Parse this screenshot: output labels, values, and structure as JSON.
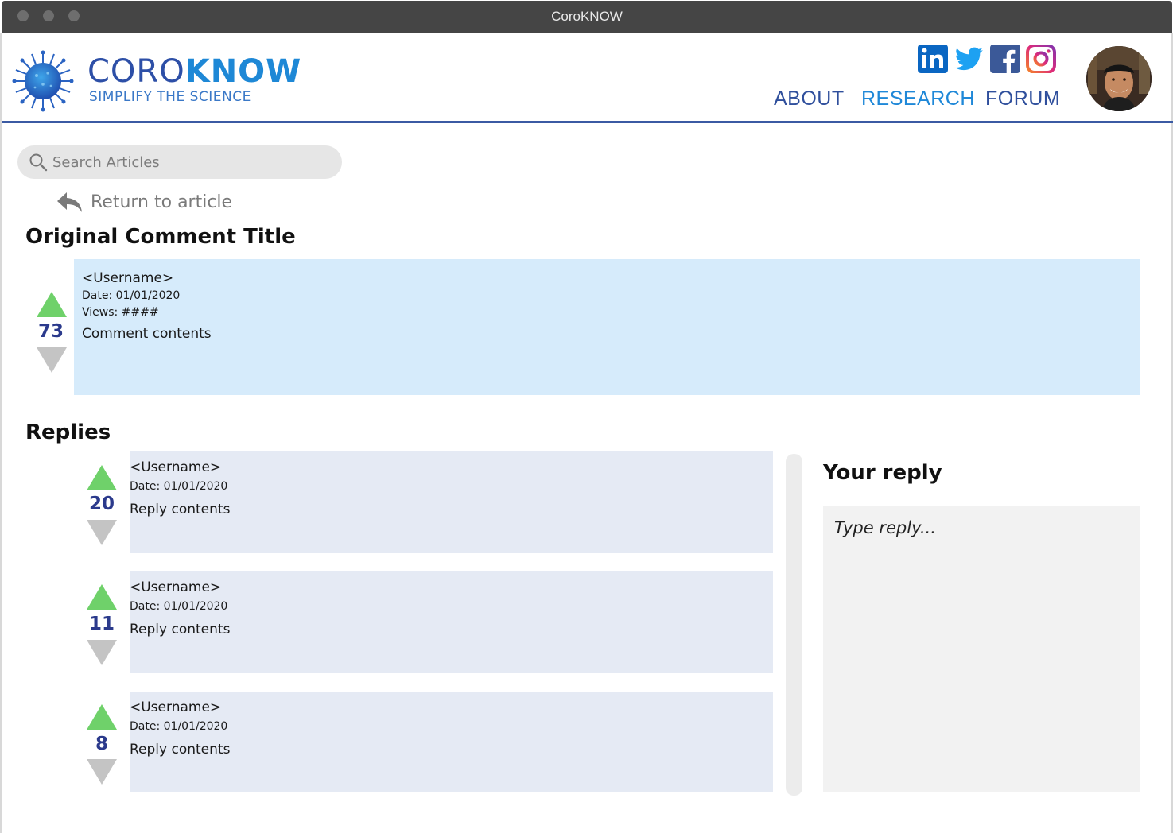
{
  "window": {
    "title": "CoroKNOW"
  },
  "brand": {
    "name_light": "CORO",
    "name_bold": "KNOW",
    "tagline": "SIMPLIFY THE SCIENCE"
  },
  "social": [
    {
      "name": "linkedin-icon",
      "label": "in",
      "color": "#0a66c2"
    },
    {
      "name": "twitter-icon",
      "color": "#1da1f2"
    },
    {
      "name": "facebook-icon",
      "label": "f",
      "color": "#3b5998"
    },
    {
      "name": "instagram-icon",
      "color": "#c13584"
    }
  ],
  "nav": {
    "about": "ABOUT",
    "research": "RESEARCH",
    "forum": "FORUM"
  },
  "search": {
    "placeholder": "Search Articles"
  },
  "return_label": "Return to article",
  "original": {
    "heading": "Original Comment Title",
    "username": "<Username>",
    "date": "Date: 01/01/2020",
    "views": "Views: ####",
    "contents": "Comment contents",
    "votes": "73"
  },
  "replies_heading": "Replies",
  "replies": [
    {
      "username": "<Username>",
      "date": "Date: 01/01/2020",
      "contents": "Reply contents",
      "votes": "20"
    },
    {
      "username": "<Username>",
      "date": "Date: 01/01/2020",
      "contents": "Reply contents",
      "votes": "11"
    },
    {
      "username": "<Username>",
      "date": "Date: 01/01/2020",
      "contents": "Reply contents",
      "votes": "8"
    }
  ],
  "your_reply": {
    "heading": "Your reply",
    "placeholder": "Type reply..."
  },
  "colors": {
    "accent": "#2f4f9c",
    "accent_light": "#1f88d8",
    "upvote": "#6fd16a",
    "downvote": "#c4c4c4",
    "original_bg": "#d6ebfb",
    "reply_bg": "#e5eaf4"
  }
}
